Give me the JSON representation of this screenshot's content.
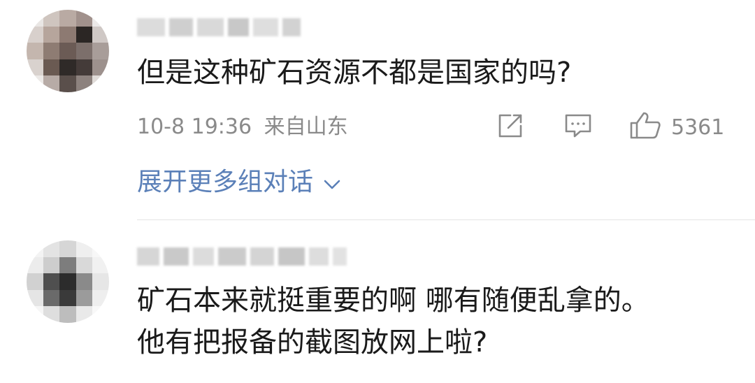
{
  "comments": [
    {
      "text_lines": [
        "但是这种矿石资源不都是国家的吗?"
      ],
      "time": "10-8 19:36",
      "location": "来自山东",
      "likes": "5361",
      "expand_label": "展开更多组对话"
    },
    {
      "text_lines": [
        "矿石本来就挺重要的啊 哪有随便乱拿的。",
        "他有把报备的截图放网上啦?"
      ]
    }
  ],
  "icons": {
    "share": "share-icon",
    "comment": "comment-icon",
    "like": "thumbs-up-icon",
    "expand": "chevron-down-icon"
  },
  "colors": {
    "link": "#5b80b8",
    "meta": "#8a8a8a",
    "text": "#1a1a1a",
    "divider": "#e4e4e4"
  }
}
